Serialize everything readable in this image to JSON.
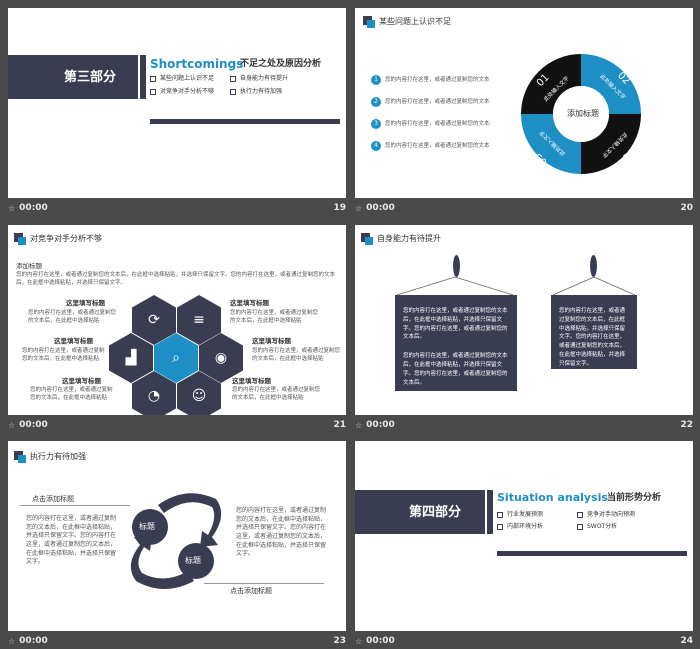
{
  "colors": {
    "navy": "#3a3d52",
    "blue": "#1e8fc4",
    "black": "#111111"
  },
  "captions": [
    {
      "time": "00:00",
      "num": "19"
    },
    {
      "time": "00:00",
      "num": "20"
    },
    {
      "time": "00:00",
      "num": "21"
    },
    {
      "time": "00:00",
      "num": "22"
    },
    {
      "time": "00:00",
      "num": "23"
    },
    {
      "time": "00:00",
      "num": "24"
    }
  ],
  "s19": {
    "section": "第三部分",
    "title_en": "Shortcomings",
    "title_cn": "不足之处及原因分析",
    "items": [
      "某些问题上认识不足",
      "自身能力有待提升",
      "对竞争对手分析不够",
      "执行力有待加强"
    ]
  },
  "s20": {
    "title": "某些问题上认识不足",
    "nums": [
      "1",
      "2",
      "3",
      "4"
    ],
    "line": "您的内容打在这里，或者通过复制您的文本",
    "center": "添加标题",
    "quads": [
      "01",
      "02",
      "03",
      "04"
    ],
    "qtext": "此处输入文字"
  },
  "s21": {
    "title": "对竞争对手分析不够",
    "sub": "添加标题",
    "para": "您的内容打在这里，或者通过复制您的文本后，在此框中选择粘贴，并选择只保留文字。您的内容打在这里，或者通过复制您的文本后，在此框中选择粘贴，并选择只保留文字。",
    "head": "这里填写标题",
    "body": "您的内容打在这里，或者通过复制您的文本后，在此框中选择粘贴"
  },
  "s22": {
    "title": "自身能力有待提升",
    "note_a": "您的内容打在这里，或者通过复制您的文本后，在此框中选择粘贴，并选择只保留文字。您的内容打在这里，或者通过复制您的文本后。",
    "note_a2": "您的内容打在这里，或者通过复制您的文本后，在此框中选择粘贴，并选择只保留文字。您的内容打在这里，或者通过复制您的文本后。",
    "note_b": "您的内容打在这里，或者通过复制您的文本后，在此框中选择粘贴，并选择只保留文字。您的内容打在这里，或者通过复制您的文本后，在此框中选择粘贴，并选择只保留文字。"
  },
  "s23": {
    "title": "执行力有待加强",
    "sub1": "点击添加标题",
    "left": "您的内容打在这里，或者通过复制您的文本后，在此框中选择粘贴，并选择只保留文字。您的内容打在这里，或者通过复制您的文本后，在此框中选择粘贴，并选择只保留文字。",
    "right": "您的内容打在这里，或者通过复制您的文本后，在此框中选择粘贴，并选择只保留文字。您的内容打在这里，或者通过复制您的文本后，在此框中选择粘贴，并选择只保留文字。",
    "c1": "标题",
    "c2": "标题",
    "sub2": "点击添加标题"
  },
  "s24": {
    "section": "第四部分",
    "title_en": "Situation analysis",
    "title_cn": "当前形势分析",
    "items": [
      "行业发展预测",
      "竞争对手动向预测",
      "内部环境分析",
      "SWOT分析"
    ]
  }
}
